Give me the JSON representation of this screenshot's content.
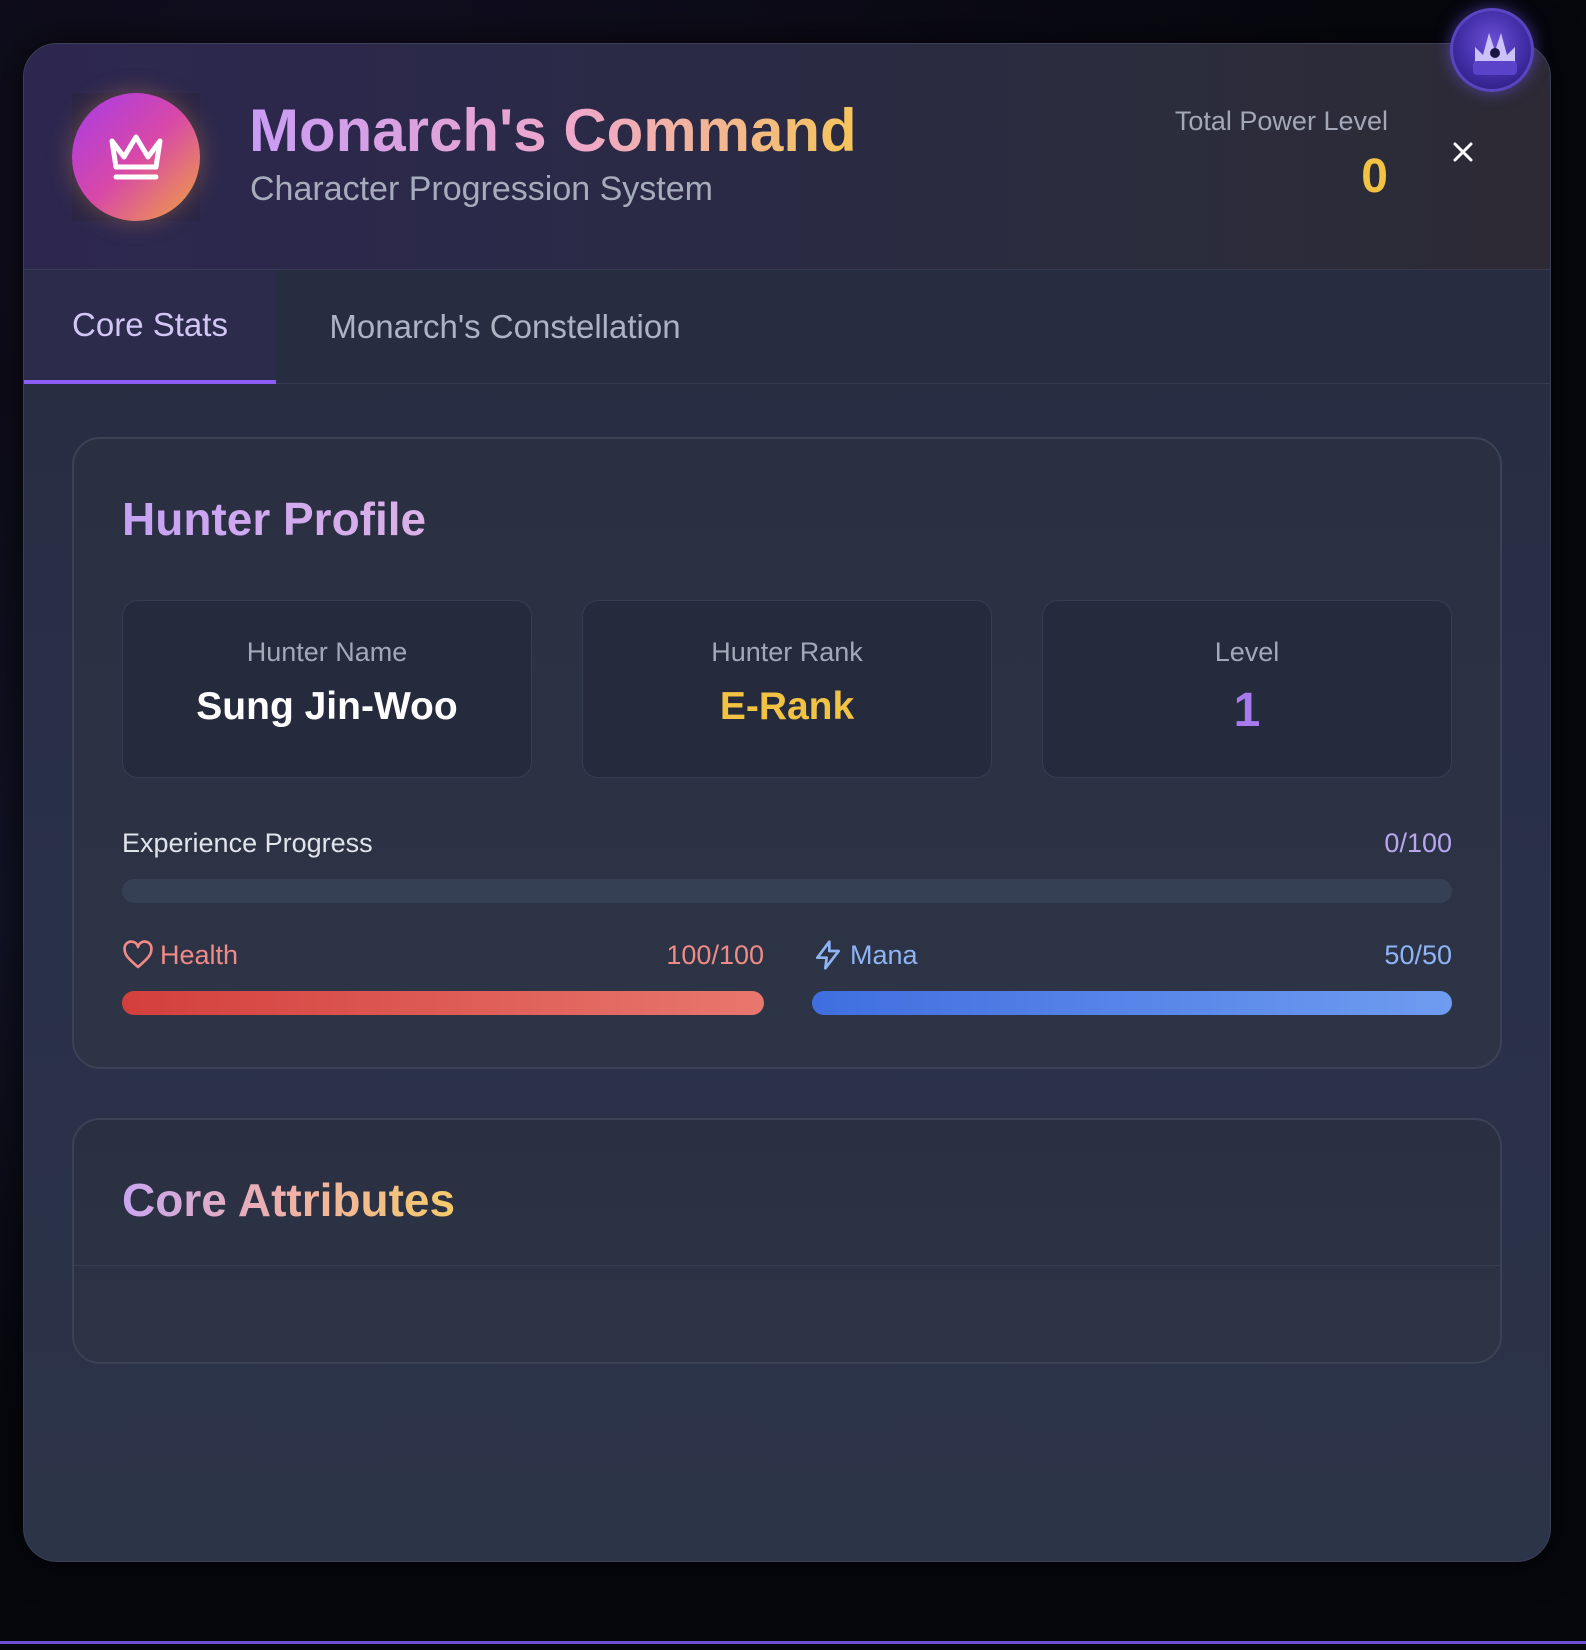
{
  "header": {
    "title": "Monarch's Command",
    "subtitle": "Character Progression System",
    "power_label": "Total Power Level",
    "power_value": "0",
    "logo_icon": "crown-icon",
    "close_icon": "close-icon"
  },
  "tabs": [
    {
      "label": "Core Stats",
      "active": true
    },
    {
      "label": "Monarch's Constellation",
      "active": false
    }
  ],
  "profile": {
    "title": "Hunter Profile",
    "name_label": "Hunter Name",
    "name_value": "Sung Jin-Woo",
    "rank_label": "Hunter Rank",
    "rank_value": "E-Rank",
    "level_label": "Level",
    "level_value": "1",
    "xp_label": "Experience Progress",
    "xp_value": "0/100",
    "xp_fraction": 0,
    "health_label": "Health",
    "health_value": "100/100",
    "health_fraction": 1,
    "health_icon": "heart-icon",
    "mana_label": "Mana",
    "mana_value": "50/50",
    "mana_fraction": 1,
    "mana_icon": "lightning-icon"
  },
  "attributes": {
    "title": "Core Attributes"
  },
  "colors": {
    "accent": "#8b5cf6",
    "gold": "#f2c243",
    "health": "#e05a55",
    "mana": "#4f7ee8"
  }
}
